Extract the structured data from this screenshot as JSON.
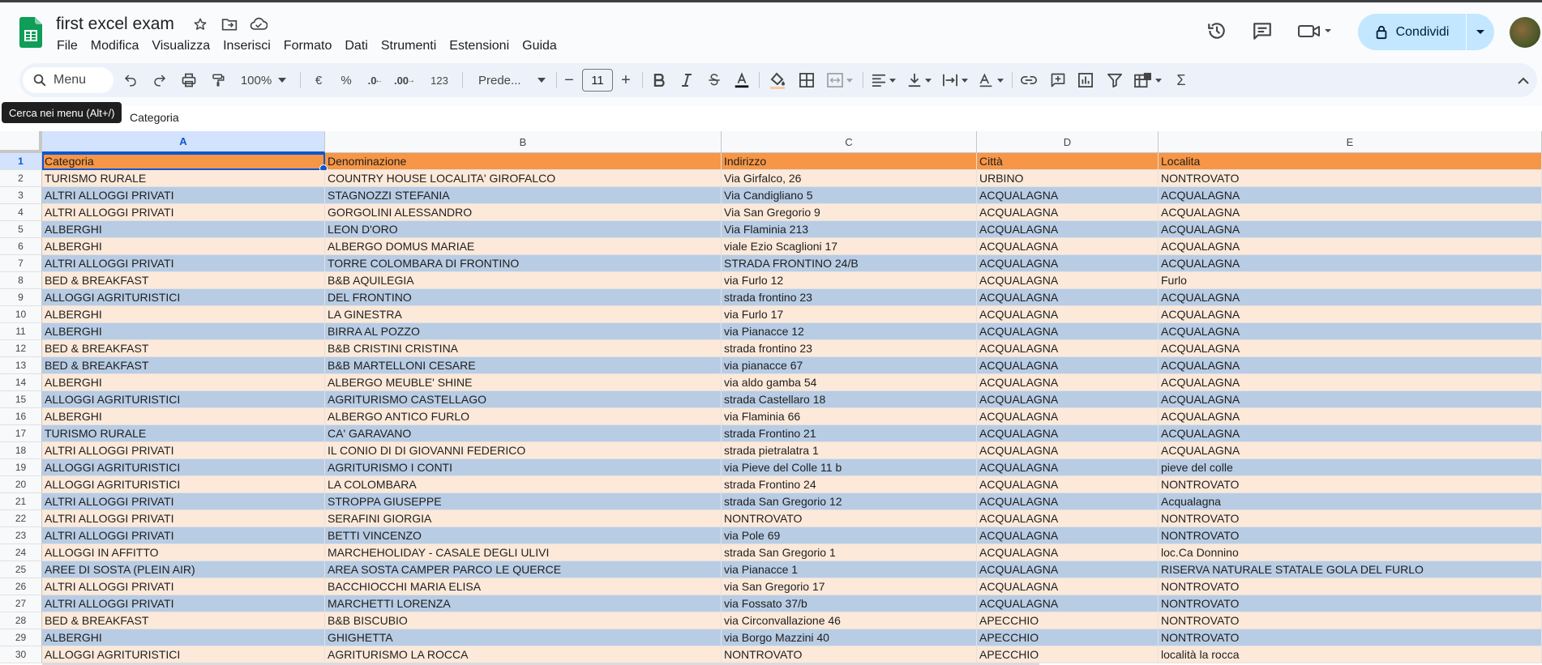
{
  "doc": {
    "title": "first excel exam"
  },
  "menu": [
    "File",
    "Modifica",
    "Visualizza",
    "Inserisci",
    "Formato",
    "Dati",
    "Strumenti",
    "Estensioni",
    "Guida"
  ],
  "header": {
    "share_label": "Condividi"
  },
  "toolbar": {
    "search_label": "Menu",
    "zoom": "100%",
    "currency": "€",
    "percent": "%",
    "dec_decrease": ".0",
    "dec_increase": ".00",
    "number_format": "123",
    "font": "Prede...",
    "font_size": "11",
    "minus": "−",
    "plus": "+"
  },
  "tooltip": "Cerca nei menu (Alt+/)",
  "formula_bar": {
    "value": "Categoria"
  },
  "columns": [
    "A",
    "B",
    "C",
    "D",
    "E"
  ],
  "rows": [
    [
      "Categoria",
      "Denominazione",
      "Indirizzo",
      "Città",
      "Localita"
    ],
    [
      "TURISMO RURALE",
      "COUNTRY HOUSE LOCALITA' GIROFALCO",
      "Via Girfalco, 26",
      "URBINO",
      "NONTROVATO"
    ],
    [
      "ALTRI ALLOGGI PRIVATI",
      "STAGNOZZI STEFANIA",
      "Via Candigliano  5",
      "ACQUALAGNA",
      "ACQUALAGNA"
    ],
    [
      "ALTRI ALLOGGI PRIVATI",
      "GORGOLINI ALESSANDRO",
      "Via San Gregorio 9",
      "ACQUALAGNA",
      "ACQUALAGNA"
    ],
    [
      "ALBERGHI",
      "LEON D'ORO",
      "Via Flaminia 213",
      "ACQUALAGNA",
      "ACQUALAGNA"
    ],
    [
      "ALBERGHI",
      "ALBERGO DOMUS MARIAE",
      "viale Ezio Scaglioni 17",
      "ACQUALAGNA",
      "ACQUALAGNA"
    ],
    [
      "ALTRI ALLOGGI PRIVATI",
      "TORRE COLOMBARA DI FRONTINO",
      "STRADA FRONTINO 24/B",
      "ACQUALAGNA",
      "ACQUALAGNA"
    ],
    [
      "BED & BREAKFAST",
      "B&B AQUILEGIA",
      "via Furlo 12",
      "ACQUALAGNA",
      "Furlo"
    ],
    [
      "ALLOGGI AGRITURISTICI",
      "DEL FRONTINO",
      "strada frontino 23",
      "ACQUALAGNA",
      "ACQUALAGNA"
    ],
    [
      "ALBERGHI",
      "LA GINESTRA",
      "via Furlo 17",
      "ACQUALAGNA",
      "ACQUALAGNA"
    ],
    [
      "ALBERGHI",
      "BIRRA AL POZZO",
      "via Pianacce 12",
      "ACQUALAGNA",
      "ACQUALAGNA"
    ],
    [
      "BED & BREAKFAST",
      "B&B CRISTINI CRISTINA",
      "strada frontino 23",
      "ACQUALAGNA",
      "ACQUALAGNA"
    ],
    [
      "BED & BREAKFAST",
      "B&B MARTELLONI CESARE",
      "via pianacce 67",
      "ACQUALAGNA",
      "ACQUALAGNA"
    ],
    [
      "ALBERGHI",
      "ALBERGO MEUBLE' SHINE",
      "via aldo gamba 54",
      "ACQUALAGNA",
      "ACQUALAGNA"
    ],
    [
      "ALLOGGI AGRITURISTICI",
      "AGRITURISMO CASTELLAGO",
      "strada Castellaro 18",
      "ACQUALAGNA",
      "ACQUALAGNA"
    ],
    [
      "ALBERGHI",
      "ALBERGO ANTICO FURLO",
      "via Flaminia 66",
      "ACQUALAGNA",
      "ACQUALAGNA"
    ],
    [
      "TURISMO RURALE",
      "CA' GARAVANO",
      "strada Frontino 21",
      "ACQUALAGNA",
      "ACQUALAGNA"
    ],
    [
      "ALTRI ALLOGGI PRIVATI",
      "IL CONIO DI DI GIOVANNI FEDERICO",
      "strada pietralatra 1",
      "ACQUALAGNA",
      "ACQUALAGNA"
    ],
    [
      "ALLOGGI AGRITURISTICI",
      "AGRITURISMO I CONTI",
      "via Pieve del Colle 11 b",
      "ACQUALAGNA",
      "pieve del colle"
    ],
    [
      "ALLOGGI AGRITURISTICI",
      "LA COLOMBARA",
      "strada Frontino 24",
      "ACQUALAGNA",
      "NONTROVATO"
    ],
    [
      "ALTRI ALLOGGI PRIVATI",
      "STROPPA GIUSEPPE",
      "strada San Gregorio 12",
      "ACQUALAGNA",
      "Acqualagna"
    ],
    [
      "ALTRI ALLOGGI PRIVATI",
      "SERAFINI GIORGIA",
      "NONTROVATO",
      "ACQUALAGNA",
      "NONTROVATO"
    ],
    [
      "ALTRI ALLOGGI PRIVATI",
      "BETTI VINCENZO",
      "via Pole 69",
      "ACQUALAGNA",
      "NONTROVATO"
    ],
    [
      "ALLOGGI IN AFFITTO",
      "MARCHEHOLIDAY - CASALE DEGLI ULIVI",
      "strada San Gregorio 1",
      "ACQUALAGNA",
      "loc.Ca Donnino"
    ],
    [
      "AREE DI SOSTA (PLEIN AIR)",
      "AREA SOSTA CAMPER PARCO LE QUERCE",
      "via Pianacce 1",
      "ACQUALAGNA",
      "RISERVA NATURALE STATALE GOLA DEL FURLO"
    ],
    [
      "ALTRI ALLOGGI PRIVATI",
      "BACCHIOCCHI MARIA ELISA",
      "via San Gregorio 17",
      "ACQUALAGNA",
      "NONTROVATO"
    ],
    [
      "ALTRI ALLOGGI PRIVATI",
      "MARCHETTI LORENZA",
      "via Fossato 37/b",
      "ACQUALAGNA",
      "NONTROVATO"
    ],
    [
      "BED & BREAKFAST",
      "B&B BISCUBIO",
      "via Circonvallazione 46",
      "APECCHIO",
      "NONTROVATO"
    ],
    [
      "ALBERGHI",
      "GHIGHETTA",
      "via Borgo Mazzini 40",
      "APECCHIO",
      "NONTROVATO"
    ],
    [
      "ALLOGGI AGRITURISTICI",
      "AGRITURISMO LA ROCCA",
      "NONTROVATO",
      "APECCHIO",
      "località la rocca"
    ]
  ],
  "colors": {
    "header_row": "#f79646",
    "band_light": "#fde9d9",
    "band_blue": "#b8cce4",
    "accent": "#0b57d0",
    "share_bg": "#c2e7ff"
  }
}
